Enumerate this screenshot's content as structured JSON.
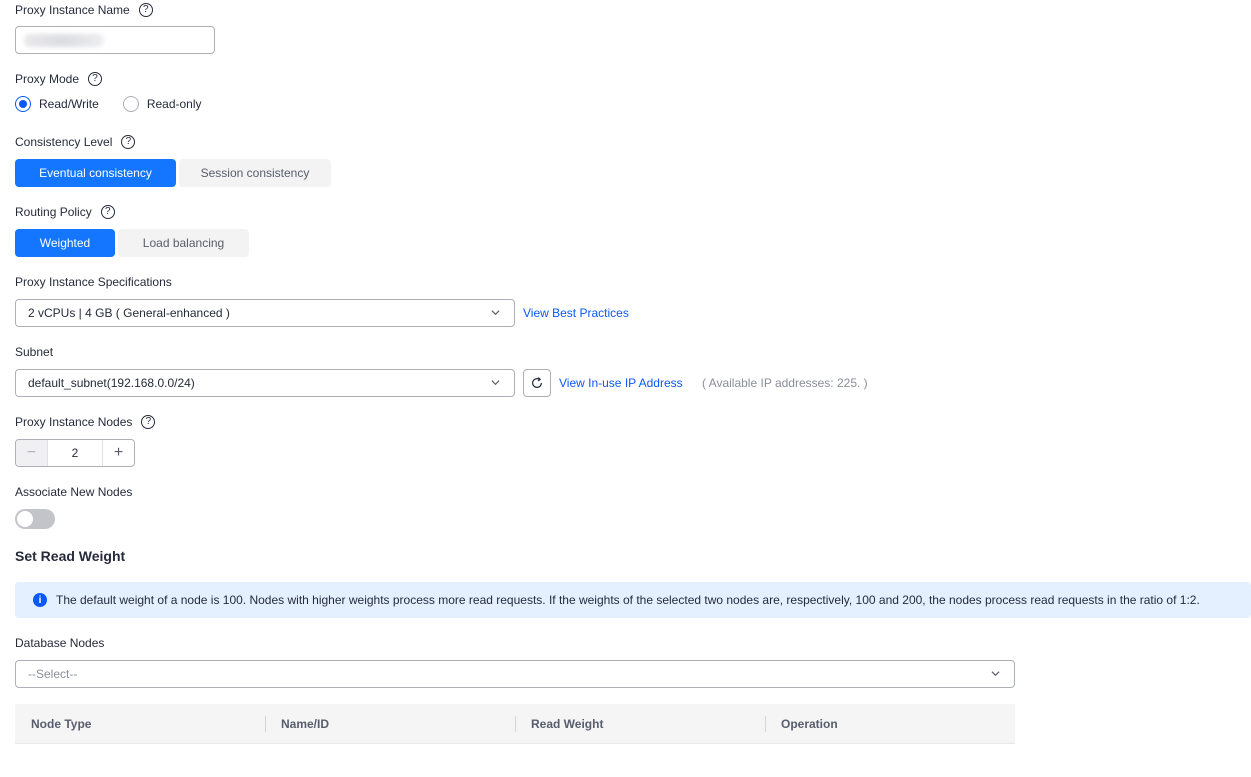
{
  "proxy_name": {
    "label": "Proxy Instance Name",
    "help": "?"
  },
  "proxy_mode": {
    "label": "Proxy Mode",
    "help": "?",
    "options": [
      {
        "label": "Read/Write",
        "checked": true
      },
      {
        "label": "Read-only",
        "checked": false
      }
    ]
  },
  "consistency": {
    "label": "Consistency Level",
    "help": "?",
    "options": [
      "Eventual consistency",
      "Session consistency"
    ],
    "selected": "Eventual consistency"
  },
  "routing": {
    "label": "Routing Policy",
    "help": "?",
    "options": [
      "Weighted",
      "Load balancing"
    ],
    "selected": "Weighted"
  },
  "specs": {
    "label": "Proxy Instance Specifications",
    "value": "2 vCPUs | 4 GB ( General-enhanced )",
    "link": "View Best Practices"
  },
  "subnet": {
    "label": "Subnet",
    "value": "default_subnet(192.168.0.0/24)",
    "link": "View In-use IP Address",
    "available": "( Available IP addresses: 225. )"
  },
  "nodes": {
    "label": "Proxy Instance Nodes",
    "help": "?",
    "value": "2",
    "minus": "−",
    "plus": "+"
  },
  "associate": {
    "label": "Associate New Nodes",
    "enabled": false
  },
  "read_weight": {
    "title": "Set Read Weight",
    "info_icon": "i",
    "info": "The default weight of a node is 100. Nodes with higher weights process more read requests. If the weights of the selected two nodes are, respectively, 100 and 200, the nodes process read requests in the ratio of 1:2."
  },
  "db_nodes": {
    "label": "Database Nodes",
    "placeholder": "--Select--"
  },
  "table": {
    "columns": [
      "Node Type",
      "Name/ID",
      "Read Weight",
      "Operation"
    ]
  },
  "colors": {
    "primary": "#1476ff",
    "link": "#0a59f7",
    "info_bg": "#e4f0ff"
  }
}
